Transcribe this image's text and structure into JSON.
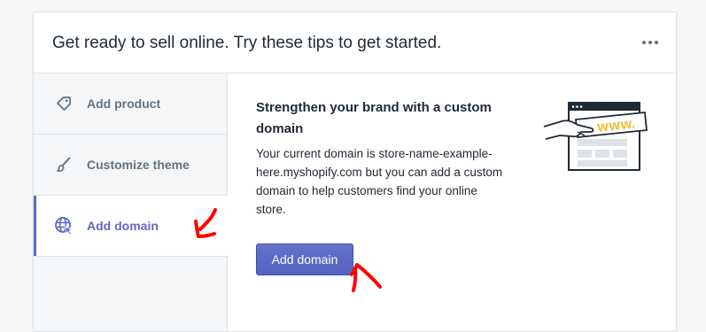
{
  "card": {
    "title": "Get ready to sell online. Try these tips to get started.",
    "more_actions_icon": "horizontal-dots-icon"
  },
  "sidebar": {
    "items": [
      {
        "label": "Add product",
        "icon": "tag-icon",
        "active": false
      },
      {
        "label": "Customize theme",
        "icon": "paintbrush-icon",
        "active": false
      },
      {
        "label": "Add domain",
        "icon": "globe-icon",
        "active": true
      }
    ]
  },
  "content": {
    "heading": "Strengthen your brand with a custom domain",
    "body": "Your current domain is store-name-example-here.myshopify.com but you can add a custom domain to help customers find your online store.",
    "button_label": "Add domain",
    "illustration": "browser-www-illustration",
    "illustration_text": "WWW."
  },
  "colors": {
    "accent": "#5c6ac4",
    "text": "#212b36",
    "muted": "#637381",
    "sidebar_bg": "#f4f6f8",
    "annotation": "#ff0000",
    "illustration_yellow": "#f2c040"
  }
}
